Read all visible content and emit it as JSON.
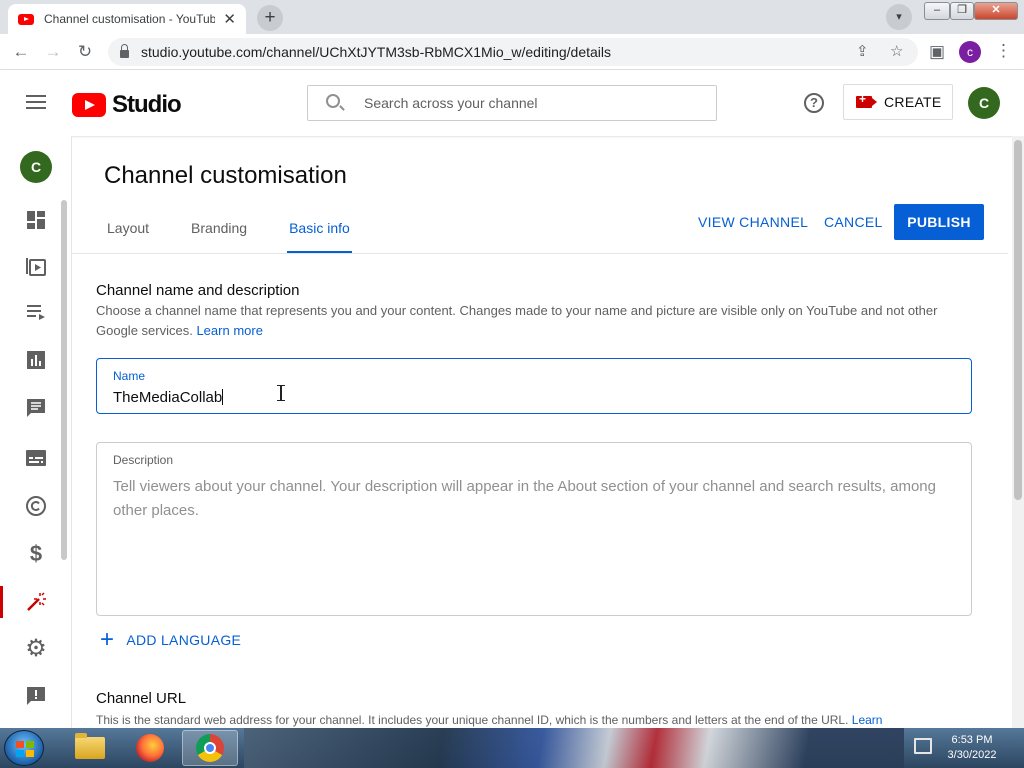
{
  "browser": {
    "tab_title": "Channel customisation - YouTube",
    "url": "studio.youtube.com/channel/UChXtJYTM3sb-RbMCX1Mio_w/editing/details",
    "profile_initial": "c"
  },
  "header": {
    "logo_text": "Studio",
    "search_placeholder": "Search across your channel",
    "help_glyph": "?",
    "create_label": "CREATE",
    "avatar_initial": "C"
  },
  "sidebar": {
    "avatar_initial": "C",
    "items": [
      {
        "name": "dashboard",
        "icon": "dashboard-icon"
      },
      {
        "name": "content",
        "icon": "video-content-icon"
      },
      {
        "name": "playlists",
        "icon": "playlist-icon"
      },
      {
        "name": "analytics",
        "icon": "analytics-icon"
      },
      {
        "name": "comments",
        "icon": "comments-icon"
      },
      {
        "name": "subtitles",
        "icon": "subtitles-icon"
      },
      {
        "name": "copyright",
        "icon": "copyright-icon"
      },
      {
        "name": "monetization",
        "icon": "dollar-icon"
      },
      {
        "name": "customisation",
        "icon": "magic-wand-icon",
        "active": true
      },
      {
        "name": "settings",
        "icon": "gear-icon"
      },
      {
        "name": "feedback",
        "icon": "feedback-icon"
      }
    ]
  },
  "page": {
    "title": "Channel customisation",
    "tabs": [
      {
        "label": "Layout",
        "selected": false
      },
      {
        "label": "Branding",
        "selected": false
      },
      {
        "label": "Basic info",
        "selected": true
      }
    ],
    "view_channel_label": "VIEW CHANNEL",
    "cancel_label": "CANCEL",
    "publish_label": "PUBLISH"
  },
  "name_section": {
    "title": "Channel name and description",
    "description": "Choose a channel name that represents you and your content. Changes made to your name and picture are visible only on YouTube and not other Google services.",
    "learn_more": "Learn more",
    "name_label": "Name",
    "name_value": "TheMediaCollab",
    "description_label": "Description",
    "description_placeholder": "Tell viewers about your channel. Your description will appear in the About section of your channel and search results, among other places."
  },
  "add_language_label": "ADD LANGUAGE",
  "url_section": {
    "title": "Channel URL",
    "description": "This is the standard web address for your channel. It includes your unique channel ID, which is the numbers and letters at the end of the URL.",
    "learn_more": "Learn"
  },
  "taskbar": {
    "time": "6:53 PM",
    "date": "3/30/2022"
  },
  "colors": {
    "accent_blue": "#065fd4",
    "youtube_red": "#ff0000",
    "avatar_green": "#33691e"
  }
}
